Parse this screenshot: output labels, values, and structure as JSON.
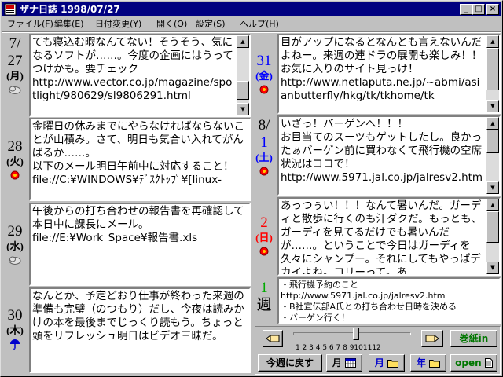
{
  "window": {
    "title": "ザナ日誌 1998/07/27",
    "minimize_glyph": "_",
    "maximize_glyph": "□",
    "close_glyph": "×"
  },
  "menu": [
    {
      "label": "ファイル(F)"
    },
    {
      "label": "編集(E)"
    },
    {
      "label": "日付変更(Y)"
    },
    {
      "label": "開く(O)"
    },
    {
      "label": "設定(S)"
    },
    {
      "label": "ヘルプ(H)"
    }
  ],
  "days": [
    {
      "month": "7/",
      "day": "27",
      "dow": "(月)",
      "weather": "cloud-icon",
      "text": "ても寝込む暇なんてない！そうそう、気になるソフトが……。今度の企画にはうってつけかも。要チェック\nhttp://www.vector.co.jp/magazine/spotlight/980629/sl9806291.html"
    },
    {
      "day": "28",
      "dow": "(火)",
      "weather": "sun-icon",
      "text": "金曜日の休みまでにやらなければならないことが山積み。さて、明日も気合い入れてがんばるか……。\n以下のメール明日午前中に対応すること！\nfile://C:¥WINDOWS¥ﾃﾞｽｸﾄｯﾌﾟ¥[linux-"
    },
    {
      "day": "29",
      "dow": "(水)",
      "weather": "cloud-icon",
      "text": "午後からの打ち合わせの報告書を再確認して本日中に課長にメール。\nfile://E:¥Work_Space¥報告書.xls"
    },
    {
      "day": "30",
      "dow": "(木)",
      "weather": "rain-icon",
      "text": "なんとか、予定どおり仕事が終わった来週の準備も完璧（のつもり）だし、今夜は読みかけの本を最後までじっくり読もう。ちょっと頭をリフレッシュ明日はビデオ三昧だ。"
    },
    {
      "day": "31",
      "dow": "(金)",
      "weather": "sun-icon",
      "text": "目がアップになるとなんとも言えないんだよねー。来週の連ドラの展開も楽しみ！！\nお気に入りのサイト見っけ！\nhttp://www.netlaputa.ne.jp/~abmi/asianbutterfly/hkg/tk/tkhome/tk"
    },
    {
      "month": "8/",
      "day": "1",
      "dow": "(土)",
      "weather": "sun-icon",
      "text": "いざっ！バーゲンへ！！！\nお目当てのスーツもゲットしたし。良かったぁバーゲン前に買わなくて飛行機の空席状況はココで！\nhttp://www.5971.jal.co.jp/jalresv2.htm"
    },
    {
      "day": "2",
      "dow": "(日)",
      "weather": "sun-icon",
      "text": "あっつぅい！！！なんて暑いんだ。ガーディと散歩に行くのも汗ダクだ。もっとも、ガーディを見てるだけでも暑いんだが……。ということで今日はガーディを久々にシャンプー。それにしてもやっぱデカイよね。コリーって。あ"
    }
  ],
  "week": {
    "num": "1",
    "label": "週",
    "text": "・飛行機予約のこと\nhttp://www.5971.jal.co.jp/jalresv2.htm\n・B社宣伝部A氏との打ち合わせ日時を決める\n・バーゲン行く！"
  },
  "toolbar": {
    "slider_ticks": "1 2 3 4 5 6 7 8 9101112",
    "slider_value": 7,
    "makigami_label": "巻紙in",
    "today_label": "今週に戻す",
    "month_label": "月",
    "month2_label": "月",
    "year_label": "年",
    "open_label": "open"
  }
}
